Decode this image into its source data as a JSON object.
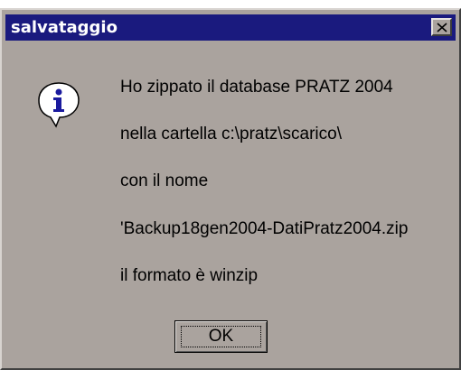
{
  "window": {
    "title": "salvataggio",
    "close_icon": "close-x-icon"
  },
  "message": {
    "icon": "information-icon",
    "lines": [
      "Ho zippato il database PRATZ 2004",
      "nella cartella c:\\pratz\\scarico\\",
      "con il nome",
      "'Backup18gen2004-DatiPratz2004.zip",
      "il formato è winzip"
    ]
  },
  "buttons": {
    "ok_label": "OK"
  },
  "colors": {
    "titlebar": "#1a1a7e",
    "dialog_bg": "#aaa39e"
  }
}
